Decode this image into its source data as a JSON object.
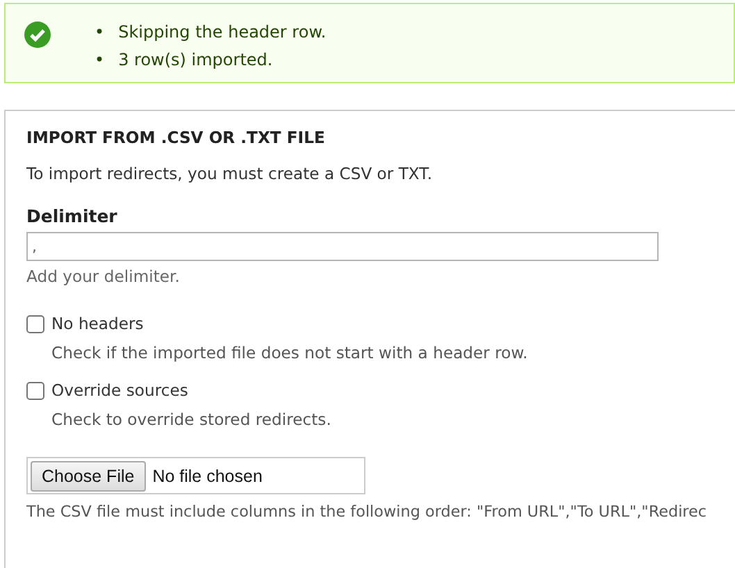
{
  "message": {
    "items": [
      {
        "bullet": "•",
        "text": "Skipping the header row."
      },
      {
        "bullet": "•",
        "text": "3 row(s) imported."
      }
    ]
  },
  "panel": {
    "title": "IMPORT FROM .CSV OR .TXT FILE",
    "intro": "To import redirects, you must create a CSV or TXT.",
    "delimiter": {
      "label": "Delimiter",
      "value": ",",
      "description": "Add your delimiter."
    },
    "options": [
      {
        "label": "No headers",
        "checked": false,
        "description": "Check if the imported file does not start with a header row."
      },
      {
        "label": "Override sources",
        "checked": false,
        "description": "Check to override stored redirects."
      }
    ],
    "file": {
      "button": "Choose File",
      "status": "No file chosen",
      "description": "The CSV file must include columns in the following order: \"From URL\",\"To URL\",\"Redirec"
    }
  }
}
